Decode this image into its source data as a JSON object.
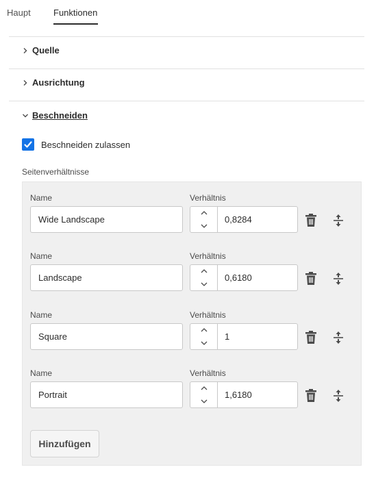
{
  "tabs": [
    {
      "label": "Haupt",
      "active": false
    },
    {
      "label": "Funktionen",
      "active": true
    }
  ],
  "sections": {
    "source": {
      "label": "Quelle",
      "expanded": false
    },
    "orientation": {
      "label": "Ausrichtung",
      "expanded": false
    },
    "crop": {
      "label": "Beschneiden",
      "expanded": true
    }
  },
  "crop": {
    "allow_checkbox": {
      "label": "Beschneiden zulassen",
      "checked": true
    },
    "ratios_label": "Seitenverhältnisse",
    "name_label": "Name",
    "ratio_label": "Verhältnis",
    "rows": [
      {
        "name": "Wide Landscape",
        "ratio": "0,8284"
      },
      {
        "name": "Landscape",
        "ratio": "0,6180"
      },
      {
        "name": "Square",
        "ratio": "1"
      },
      {
        "name": "Portrait",
        "ratio": "1,6180"
      }
    ],
    "add_button": "Hinzufügen"
  },
  "icons": {
    "chevron_right": "chevron-right-icon",
    "chevron_down": "chevron-down-icon",
    "checkmark": "checkmark-icon",
    "stepper_up": "chevron-up-icon",
    "stepper_down": "chevron-down-icon",
    "delete": "trash-icon",
    "reorder": "drag-reorder-icon"
  },
  "colors": {
    "accent": "#1473e6",
    "panel_bg": "#f0f0f0",
    "text": "#2c2c2c"
  }
}
